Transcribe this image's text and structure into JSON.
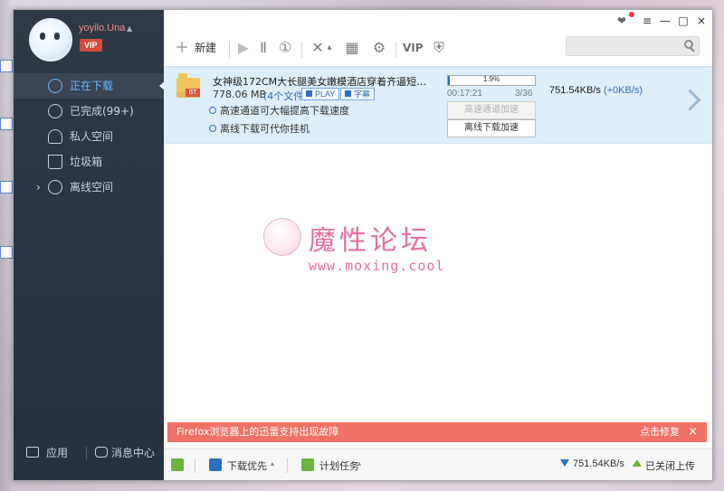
{
  "colors": {
    "sidebar_bg": "#2f3945",
    "active_blue": "#66b6ff",
    "task_row_bg": "#deeefa",
    "banner_bg": "#f07167",
    "watermark_pink": "#e46fa3"
  },
  "user": {
    "name": "yoyilo.Una",
    "vip_label": "VIP"
  },
  "sidebar": {
    "items": [
      {
        "label": "正在下载",
        "icon": "download-icon"
      },
      {
        "label": "已完成(99+)",
        "icon": "checkmark-icon"
      },
      {
        "label": "私人空间",
        "icon": "user-icon"
      },
      {
        "label": "垃圾箱",
        "icon": "trash-icon"
      },
      {
        "label": "离线空间",
        "icon": "cloud-icon"
      }
    ],
    "bottom": {
      "apps_label": "应用",
      "messages_label": "消息中心"
    }
  },
  "toolbar": {
    "new_label": "新建",
    "vip_label": "VIP",
    "search_placeholder": ""
  },
  "task": {
    "title": "女神级172CM大长腿美女嫩模酒店穿着齐逼短裙装趴在…",
    "size": "778.06 MB",
    "files": "(4个文件)",
    "play_label": "PLAY",
    "subtitle_label": "字幕",
    "hint1": "高速通道可大幅提高下载速度",
    "hint2": "离线下载可代你挂机",
    "progress_text": "1.9%",
    "progress_fraction": 0.019,
    "elapsed": "00:17:21",
    "pieces": "3/36",
    "btn_high_speed": "高速通道加速",
    "btn_offline": "离线下载加速",
    "speed": "751.54KB/s",
    "speed_extra": "(+0KB/s)"
  },
  "watermark": {
    "title": "魔性论坛",
    "url": "www.moxing.cool"
  },
  "banner": {
    "text": "Firefox浏览器上的迅雷支持出现故障",
    "action": "点击修复",
    "close": "×"
  },
  "statusbar": {
    "download_priority": "下载优先",
    "schedule": "计划任务",
    "speed": "751.54KB/s",
    "upload_status": "已关闭上传"
  }
}
